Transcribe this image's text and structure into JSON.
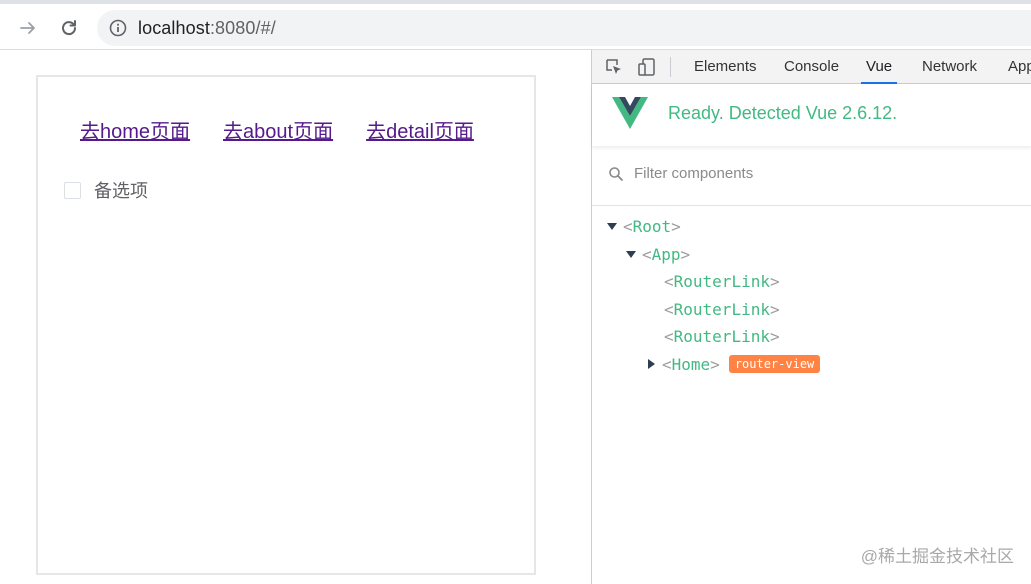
{
  "browser": {
    "url_host": "localhost",
    "url_rest": ":8080/#/"
  },
  "page": {
    "links": [
      "去home页面",
      "去about页面",
      "去detail页面"
    ],
    "checkbox_label": "备选项"
  },
  "devtools": {
    "tabs": [
      "Elements",
      "Console",
      "Vue",
      "Network",
      "App"
    ],
    "active_tab": "Vue",
    "vue_status": "Ready. Detected Vue 2.6.12.",
    "filter_placeholder": "Filter components",
    "tree": {
      "root": "Root",
      "app": "App",
      "router_links": [
        "RouterLink",
        "RouterLink",
        "RouterLink"
      ],
      "home": "Home",
      "home_badge": "router-view"
    }
  },
  "watermark": "@稀土掘金技术社区",
  "colors": {
    "vue_green": "#42b983",
    "badge_orange": "#ff8344",
    "visited_link": "#551a8b",
    "active_tab_underline": "#1a73e8"
  }
}
